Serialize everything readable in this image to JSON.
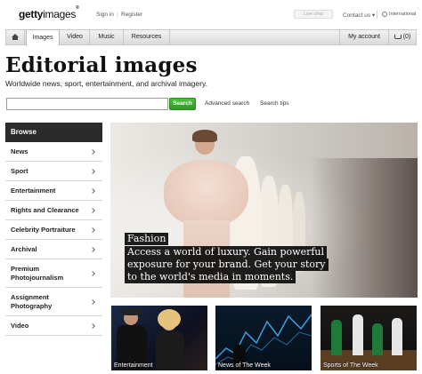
{
  "header": {
    "logo_bold": "getty",
    "logo_thin": "images",
    "logo_mark": "®",
    "sign_in": "Sign in",
    "separator": "|",
    "register": "Register",
    "live_chat": "Live chat",
    "contact_us": "Contact us ▾",
    "region": "International"
  },
  "nav": {
    "home_icon": "home-icon",
    "tabs": [
      "Images",
      "Video",
      "Music",
      "Resources"
    ],
    "my_account": "My account",
    "cart_count": "(0)"
  },
  "page": {
    "title": "Editorial images",
    "subtitle": "Worldwide news, sport, entertainment, and archival imagery."
  },
  "search": {
    "value": "",
    "placeholder": "",
    "button": "Search",
    "advanced": "Advanced search",
    "tips": "Search tips"
  },
  "sidebar": {
    "heading": "Browse",
    "items": [
      "News",
      "Sport",
      "Entertainment",
      "Rights and Clearance",
      "Celebrity Portraiture",
      "Archival",
      "Premium Photojournalism",
      "Assignment Photography",
      "Video"
    ]
  },
  "hero": {
    "caption_line1": "Fashion",
    "caption_line2": "Access a world of luxury. Gain powerful",
    "caption_line3": "exposure for your brand. Get your story",
    "caption_line4": "to the world's media in moments."
  },
  "thumbnails": [
    "Entertainment",
    "News of The Week",
    "Sports of The Week"
  ],
  "colors": {
    "search_green": "#2e9a22",
    "sidebar_header": "#2b2b2b"
  }
}
